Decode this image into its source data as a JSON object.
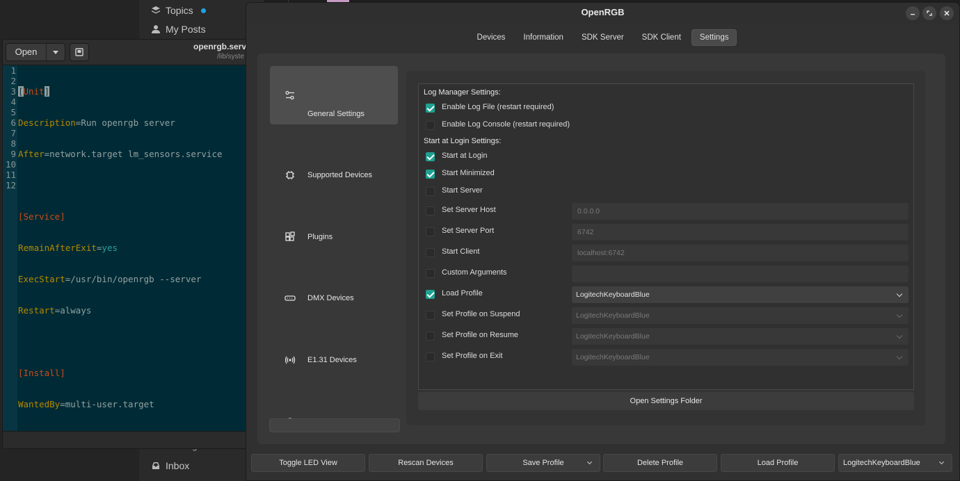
{
  "forum": {
    "topics_label": "Topics",
    "my_posts_label": "My Posts",
    "messages_label": "Messages",
    "inbox_label": "Inbox"
  },
  "gedit": {
    "open_label": "Open",
    "file_title": "openrgb.serv",
    "file_path": "/lib/syste",
    "line_numbers": [
      "1",
      "2",
      "3",
      "4",
      "5",
      "6",
      "7",
      "8",
      "9",
      "10",
      "11",
      "12"
    ]
  },
  "openrgb": {
    "window_title": "OpenRGB",
    "tabs": [
      {
        "label": "Devices"
      },
      {
        "label": "Information"
      },
      {
        "label": "SDK Server"
      },
      {
        "label": "SDK Client"
      },
      {
        "label": "Settings",
        "active": true
      }
    ],
    "sidebar": [
      {
        "label": "General Settings",
        "icon": "sliders-icon",
        "active": true
      },
      {
        "label": "Supported Devices",
        "icon": "chip-icon"
      },
      {
        "label": "Plugins",
        "icon": "plugins-icon"
      },
      {
        "label": "DMX Devices",
        "icon": "dmx-icon"
      },
      {
        "label": "E1.31 Devices",
        "icon": "wireless-icon"
      }
    ],
    "settings": {
      "log_manager_title": "Log Manager Settings:",
      "enable_log_file": {
        "label": "Enable Log File (restart required)",
        "checked": true
      },
      "enable_log_console": {
        "label": "Enable Log Console (restart required)",
        "checked": false
      },
      "start_login_title": "Start at Login Settings:",
      "start_at_login": {
        "label": "Start at Login",
        "checked": true
      },
      "start_minimized": {
        "label": "Start Minimized",
        "checked": true
      },
      "start_server": {
        "label": "Start Server",
        "checked": false
      },
      "set_server_host": {
        "label": "Set Server Host",
        "checked": false,
        "value": "0.0.0.0"
      },
      "set_server_port": {
        "label": "Set Server Port",
        "checked": false,
        "value": "6742"
      },
      "start_client": {
        "label": "Start Client",
        "checked": false,
        "value": "localhost:6742"
      },
      "custom_arguments": {
        "label": "Custom Arguments",
        "checked": false,
        "value": ""
      },
      "load_profile": {
        "label": "Load Profile",
        "checked": true,
        "value": "LogitechKeyboardBlue"
      },
      "profile_on_suspend": {
        "label": "Set Profile on Suspend",
        "checked": false,
        "value": "LogitechKeyboardBlue"
      },
      "profile_on_resume": {
        "label": "Set Profile on Resume",
        "checked": false,
        "value": "LogitechKeyboardBlue"
      },
      "profile_on_exit": {
        "label": "Set Profile on Exit",
        "checked": false,
        "value": "LogitechKeyboardBlue"
      },
      "open_folder_label": "Open Settings Folder"
    },
    "bottom_bar": {
      "toggle_led": "Toggle LED View",
      "rescan": "Rescan Devices",
      "save_profile": "Save Profile",
      "delete_profile": "Delete Profile",
      "load_profile": "Load Profile",
      "profile_select": "LogitechKeyboardBlue"
    },
    "accent_color": "#1fa090"
  }
}
